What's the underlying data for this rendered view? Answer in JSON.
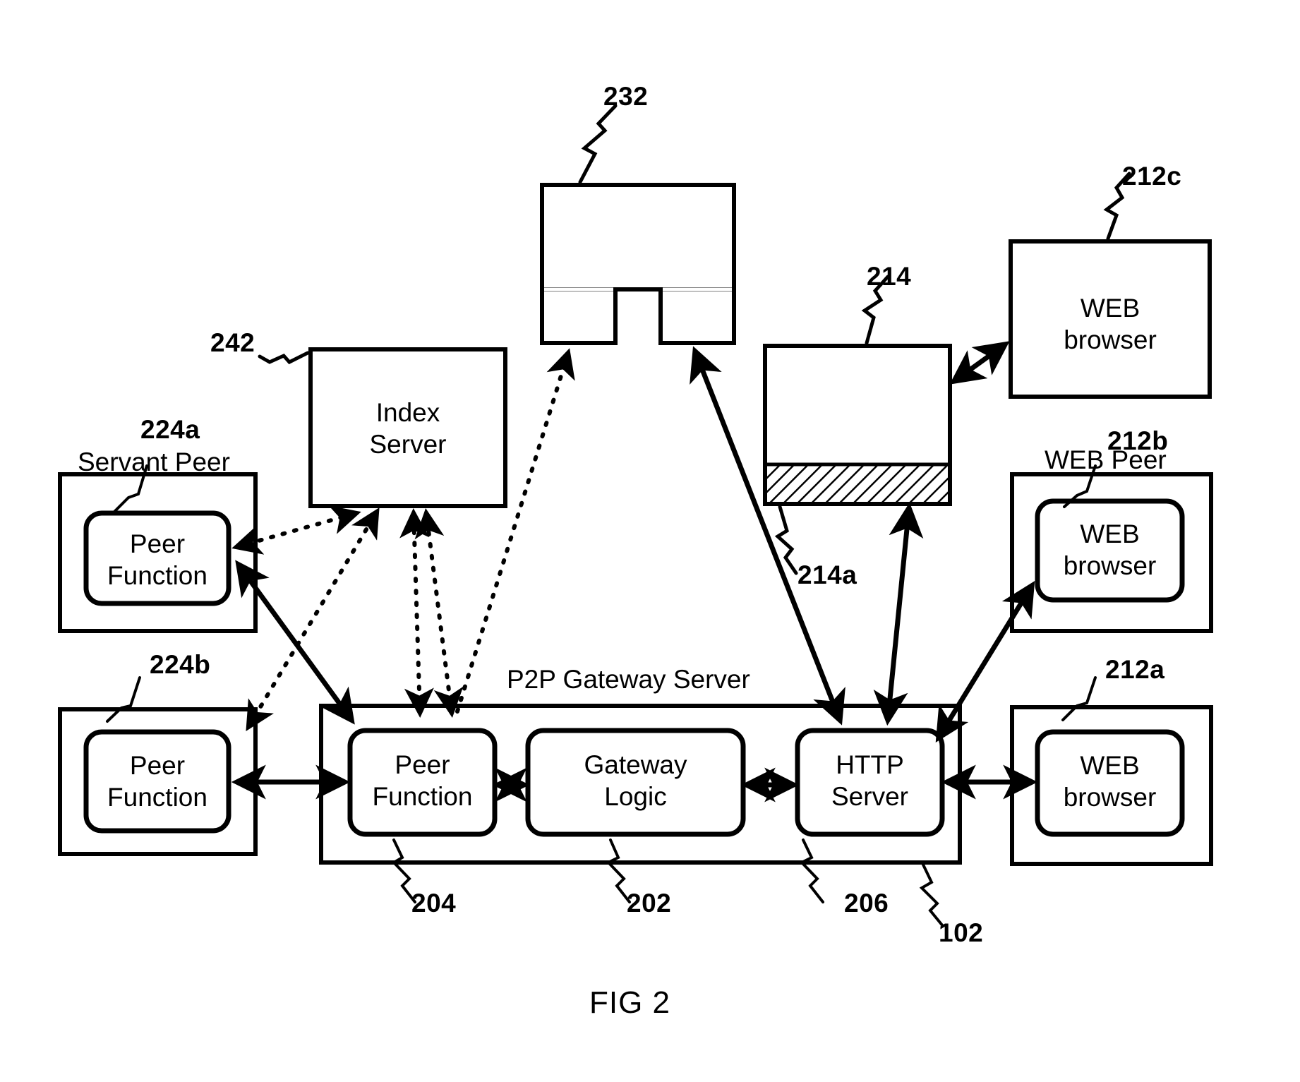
{
  "figure": {
    "caption": "FIG 2",
    "title_label": "P2P Gateway Server"
  },
  "colors": {
    "stroke": "#000000",
    "background": "#ffffff",
    "hatch": "#000000"
  },
  "nodes": {
    "index_server": {
      "label": "Index\nServer",
      "line1": "Index",
      "line2": "Server",
      "ref": "242"
    },
    "network_cloud": {
      "ref": "232"
    },
    "web_server_store": {
      "ref": "214",
      "hatch_ref": "214a"
    },
    "servant_peer": {
      "group_label": "Servant Peer",
      "ref": "224a",
      "inner_line1": "Peer",
      "inner_line2": "Function"
    },
    "peer_224b": {
      "ref": "224b",
      "inner_line1": "Peer",
      "inner_line2": "Function"
    },
    "gateway_peer_function": {
      "ref": "204",
      "line1": "Peer",
      "line2": "Function"
    },
    "gateway_logic": {
      "ref": "202",
      "line1": "Gateway",
      "line2": "Logic"
    },
    "http_server": {
      "ref": "206",
      "line1": "HTTP",
      "line2": "Server"
    },
    "gateway_server": {
      "ref": "102",
      "label": "P2P Gateway Server"
    },
    "web_peer_212c": {
      "ref": "212c",
      "line1": "WEB",
      "line2": "browser"
    },
    "web_peer_212b": {
      "ref": "212b",
      "group_label": "WEB Peer",
      "line1": "WEB",
      "line2": "browser"
    },
    "web_peer_212a": {
      "ref": "212a",
      "line1": "WEB",
      "line2": "browser"
    }
  },
  "reference_numbers": [
    {
      "id": "232",
      "value": "232"
    },
    {
      "id": "212c",
      "value": "212c"
    },
    {
      "id": "214",
      "value": "214"
    },
    {
      "id": "242",
      "value": "242"
    },
    {
      "id": "224a",
      "value": "224a"
    },
    {
      "id": "212b",
      "value": "212b"
    },
    {
      "id": "214a",
      "value": "214a"
    },
    {
      "id": "224b",
      "value": "224b"
    },
    {
      "id": "212a",
      "value": "212a"
    },
    {
      "id": "204",
      "value": "204"
    },
    {
      "id": "202",
      "value": "202"
    },
    {
      "id": "206",
      "value": "206"
    },
    {
      "id": "102",
      "value": "102"
    }
  ],
  "text_labels": {
    "servant_peer": "Servant Peer",
    "web_peer": "WEB Peer",
    "p2p_gateway_server": "P2P Gateway Server",
    "index": "Index",
    "server": "Server",
    "peer": "Peer",
    "function": "Function",
    "gateway": "Gateway",
    "logic": "Logic",
    "http": "HTTP",
    "web": "WEB",
    "browser": "browser",
    "fig": "FIG 2"
  }
}
